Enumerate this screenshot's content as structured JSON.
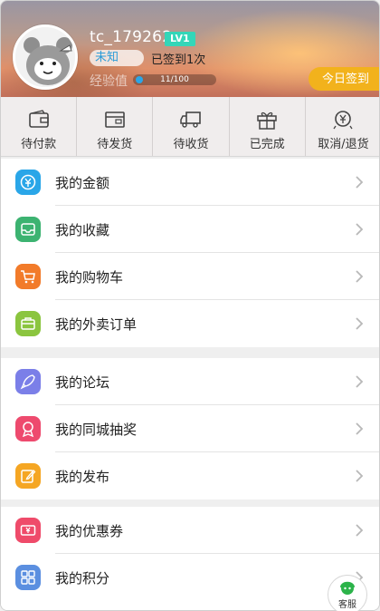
{
  "profile": {
    "username": "tc_179262",
    "level": "LV1",
    "gender": "未知",
    "signed_count": "已签到1次",
    "exp_label": "经验值",
    "exp_text": "11/100",
    "exp_progress": 0.11,
    "signin_button": "今日签到"
  },
  "orders": [
    {
      "label": "待付款",
      "icon": "wallet-icon"
    },
    {
      "label": "待发货",
      "icon": "package-icon"
    },
    {
      "label": "待收货",
      "icon": "truck-icon"
    },
    {
      "label": "已完成",
      "icon": "gift-icon"
    },
    {
      "label": "取消/退货",
      "icon": "refund-icon"
    }
  ],
  "menu": {
    "group1": [
      {
        "label": "我的金额",
        "icon": "yen-icon",
        "color": "#2aa6e8"
      },
      {
        "label": "我的收藏",
        "icon": "inbox-icon",
        "color": "#3cb371"
      },
      {
        "label": "我的购物车",
        "icon": "cart-icon",
        "color": "#f27b2a"
      },
      {
        "label": "我的外卖订单",
        "icon": "briefcase-icon",
        "color": "#8bc53f"
      }
    ],
    "group2": [
      {
        "label": "我的论坛",
        "icon": "rocket-icon",
        "color": "#7b7fe8"
      },
      {
        "label": "我的同城抽奖",
        "icon": "medal-icon",
        "color": "#ee4a6e"
      },
      {
        "label": "我的发布",
        "icon": "edit-icon",
        "color": "#f5a623"
      }
    ],
    "group3": [
      {
        "label": "我的优惠券",
        "icon": "coupon-icon",
        "color": "#ef4b6a"
      },
      {
        "label": "我的积分",
        "icon": "grid-icon",
        "color": "#5b8fe0"
      }
    ]
  },
  "service": {
    "label": "客服"
  }
}
